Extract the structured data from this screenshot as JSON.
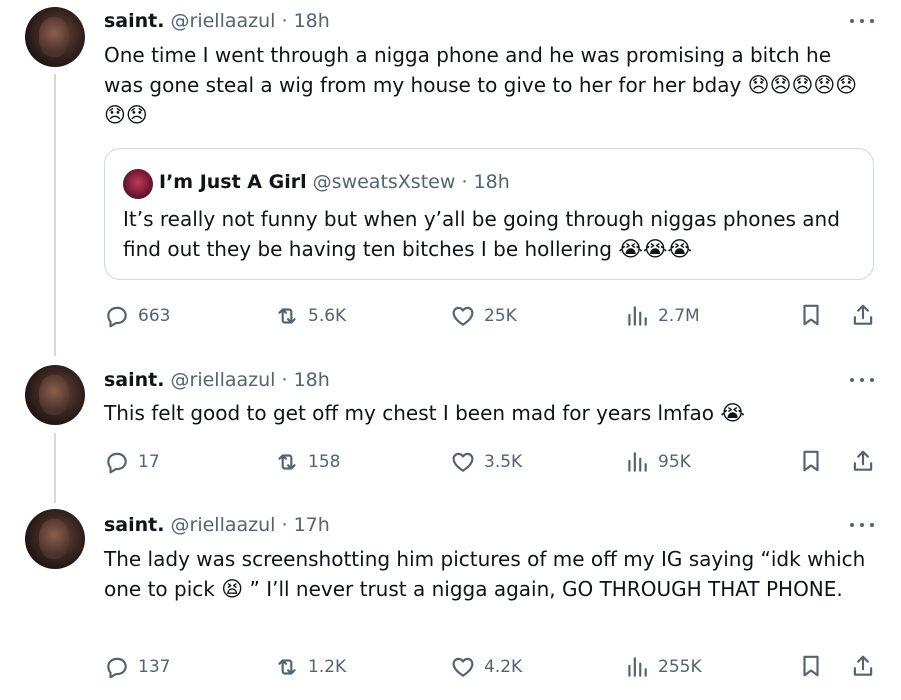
{
  "tweets": [
    {
      "name": "saint.",
      "handle": "@riellaazul",
      "time": "· 18h",
      "text": "One time I went through a nigga phone and he was promising a bitch he was gone steal a wig from my house to give to her for her bday",
      "emojis": "😞😞😞😞😞😞😞",
      "quote": {
        "name": "I’m Just A Girl",
        "handle": "@sweatsXstew",
        "time": "· 18h",
        "text": "It’s really not funny but when y’all be going through niggas phones and find out they be having ten bitches I be hollering",
        "emojis": "😭😭😭"
      },
      "replies": "663",
      "reposts": "5.6K",
      "likes": "25K",
      "views": "2.7M"
    },
    {
      "name": "saint.",
      "handle": "@riellaazul",
      "time": "· 18h",
      "text": "This felt good to get off my chest I been mad for years lmfao",
      "emojis": "😭",
      "replies": "17",
      "reposts": "158",
      "likes": "3.5K",
      "views": "95K"
    },
    {
      "name": "saint.",
      "handle": "@riellaazul",
      "time": "· 17h",
      "text_before": "The lady was screenshotting him pictures of me off my IG saying “idk which one to pick",
      "emojis": "😫",
      "text_after": "” I’ll never trust a nigga again, GO THROUGH THAT PHONE.",
      "replies": "137",
      "reposts": "1.2K",
      "likes": "4.2K",
      "views": "255K"
    }
  ],
  "icons": {
    "reply": "reply-icon",
    "repost": "repost-icon",
    "like": "like-icon",
    "views": "views-icon",
    "bookmark": "bookmark-icon",
    "share": "share-icon",
    "more": "more-icon"
  },
  "colors": {
    "text": "#0f1419",
    "secondary": "#536471",
    "border": "#cfd9de"
  }
}
